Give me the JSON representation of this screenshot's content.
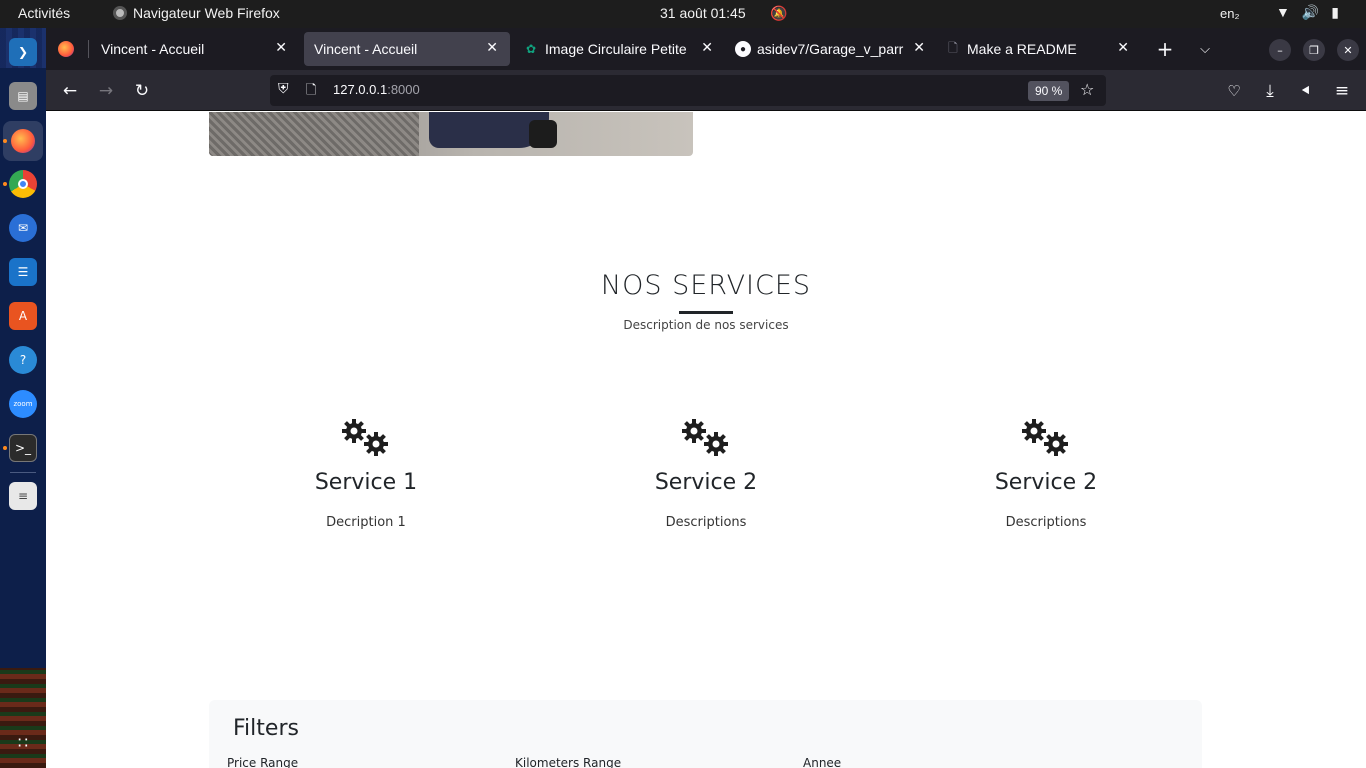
{
  "topbar": {
    "activities": "Activités",
    "app_name": "Navigateur Web Firefox",
    "clock": "31 août  01:45",
    "lang": "en₂"
  },
  "dock": {
    "apps": [
      "vscode-icon",
      "files-icon",
      "firefox-icon",
      "chrome-icon",
      "thunderbird-icon",
      "writer-icon",
      "app-center-icon",
      "help-icon",
      "zoom-icon",
      "terminal-icon",
      "text-editor-icon"
    ],
    "zoom_label": "zoom"
  },
  "browser": {
    "tabs": [
      {
        "label": "Vincent - Accueil",
        "active": false
      },
      {
        "label": "Vincent - Accueil",
        "active": true
      },
      {
        "label": "Image Circulaire Petite",
        "active": false
      },
      {
        "label": "asidev7/Garage_v_parr",
        "active": false
      },
      {
        "label": "Make a README",
        "active": false
      }
    ],
    "url_host": "127.0.0.1",
    "url_port": ":8000",
    "zoom_level": "90 %"
  },
  "page": {
    "section_title": "NOS SERVICES",
    "section_subtitle": "Description de nos services",
    "services": [
      {
        "title": "Service 1",
        "description": "Decription 1"
      },
      {
        "title": "Service 2",
        "description": "Descriptions"
      },
      {
        "title": "Service 2",
        "description": "Descriptions"
      }
    ],
    "filters": {
      "title": "Filters",
      "labels": [
        "Price Range",
        "Kilometers Range",
        "Annee"
      ]
    }
  }
}
